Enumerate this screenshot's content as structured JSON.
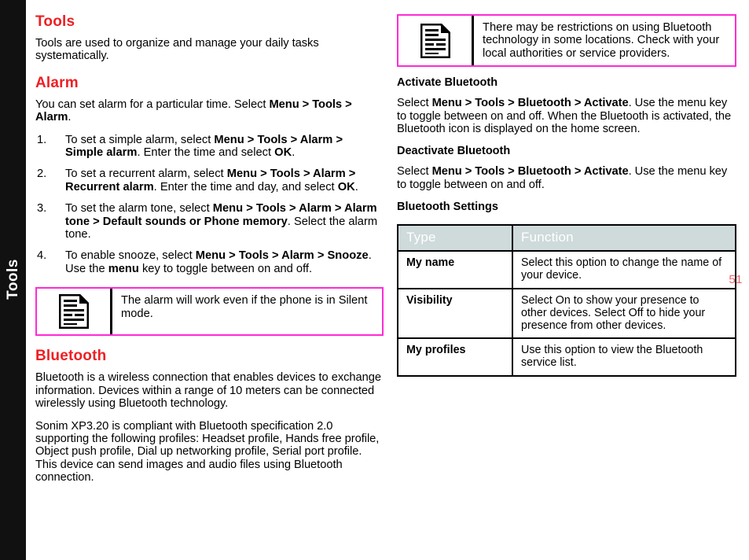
{
  "side_tab": {
    "label": "Tools"
  },
  "folio": {
    "page_number": "51"
  },
  "colors": {
    "heading_red": "#ED2024",
    "note_border_magenta": "#FF2BD6",
    "table_header_bg": "#CFDADA",
    "side_tab_bg": "#111111",
    "folio_color": "#F4616A"
  },
  "left_column": {
    "tools_heading": "Tools",
    "tools_intro": "Tools are used to organize and manage your daily tasks systematically.",
    "alarm_heading": "Alarm",
    "alarm_intro_pre": "You can set alarm for a particular time. Select ",
    "alarm_intro_bold": "Menu > Tools > Alarm",
    "alarm_intro_post": ".",
    "steps": [
      {
        "number": "1.",
        "pre": "To set a simple alarm, select ",
        "bold1": "Menu > Tools > Alarm > Simple alarm",
        "mid": ". Enter the time and select ",
        "bold2": "OK",
        "post": "."
      },
      {
        "number": "2.",
        "pre": "To set a recurrent alarm, select ",
        "bold1": "Menu > Tools > Alarm > Recurrent alarm",
        "mid": ". Enter the time and day, and select ",
        "bold2": "OK",
        "post": "."
      },
      {
        "number": "3.",
        "pre": "To set the alarm tone, select ",
        "bold1": "Menu > Tools > Alarm > Alarm tone > Default sounds or Phone memory",
        "mid": ". Select the alarm tone.",
        "bold2": "",
        "post": ""
      },
      {
        "number": "4.",
        "pre": "To enable snooze, select ",
        "bold1": "Menu > Tools > Alarm > Snooze",
        "mid": ". Use the ",
        "bold2": "menu",
        "post": " key to toggle between on and off."
      }
    ],
    "note": {
      "icon": "document-note-icon",
      "text": "The alarm will work even if the phone is in Silent mode."
    },
    "bluetooth_heading": "Bluetooth",
    "bluetooth_p1": "Bluetooth is a wireless connection that enables devices to exchange information. Devices within a range of 10 meters can be connected wirelessly using Bluetooth technology.",
    "bluetooth_p2": "Sonim XP3.20 is compliant with Bluetooth specification 2.0 supporting the following profiles: Headset profile, Hands free profile, Object push profile, Dial up networking profile, Serial port profile. This device can send images and audio files using Bluetooth connection."
  },
  "right_column": {
    "note": {
      "icon": "document-note-icon",
      "text": "There may be restrictions on using Bluetooth technology in some locations. Check with your local authorities or service providers."
    },
    "activate_heading": "Activate Bluetooth",
    "activate_pre": "Select ",
    "activate_bold": "Menu > Tools > Bluetooth  > Activate",
    "activate_post": ". Use the menu key to toggle between on and off. When the Bluetooth is activated, the Bluetooth icon is displayed on the home screen.",
    "deactivate_heading": "Deactivate Bluetooth",
    "deactivate_pre": "Select ",
    "deactivate_bold": "Menu > Tools > Bluetooth  > Activate",
    "deactivate_post": ". Use the menu key to toggle between on and off.",
    "settings_heading": "Bluetooth Settings",
    "settings_table": {
      "headers": [
        "Type",
        "Function"
      ],
      "rows": [
        {
          "type": "My name",
          "function": "Select this option to change the name of your device."
        },
        {
          "type": "Visibility",
          "function": "Select On to show your presence to other devices. Select Off to hide your presence from other devices."
        },
        {
          "type": "My profiles",
          "function": "Use this option to view the Bluetooth service list."
        }
      ]
    }
  }
}
